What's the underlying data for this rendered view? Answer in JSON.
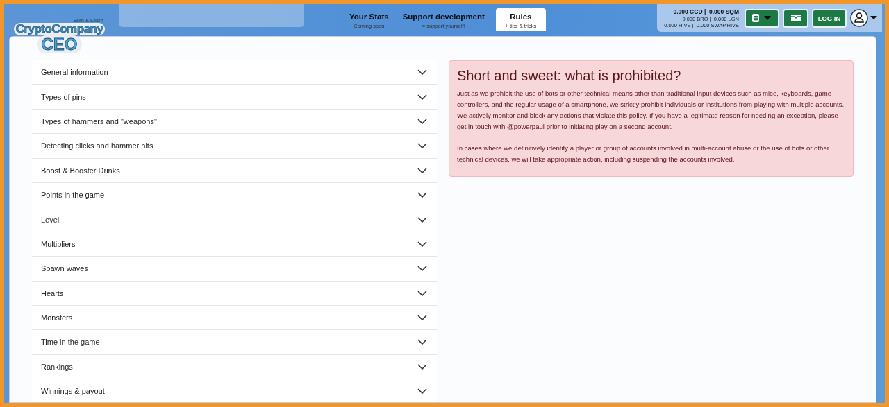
{
  "logo": {
    "top": "CryptoCompany",
    "main": "CEO",
    "tagline": "Earn & Learn"
  },
  "tabs": [
    {
      "label": "Your Stats",
      "sub": "Coming soon",
      "selected": false
    },
    {
      "label": "Support development",
      "sub": "= support yourself!",
      "selected": false
    },
    {
      "label": "Rules",
      "sub": "+ tips & tricks",
      "selected": true
    }
  ],
  "balances": {
    "main": "0.000 CCD |  0.000 SQM",
    "line_2": "0.000 BRO |  0.000 LGN",
    "line_3": "0.000 HIVE |  0.000 SWAP.HIVE"
  },
  "login_button": "LOG IN",
  "sections": [
    {
      "title": "General information",
      "expanded": false
    },
    {
      "title": "Types of pins",
      "expanded": false
    },
    {
      "title": "Types of hammers and \"weapons\"",
      "expanded": false
    },
    {
      "title": "Detecting clicks and hammer hits",
      "expanded": false
    },
    {
      "title": "Boost & Booster Drinks",
      "expanded": false
    },
    {
      "title": "Points in the game",
      "expanded": false
    },
    {
      "title": "Level",
      "expanded": false
    },
    {
      "title": "Multipliers",
      "expanded": false
    },
    {
      "title": "Spawn waves",
      "expanded": false
    },
    {
      "title": "Hearts",
      "expanded": false
    },
    {
      "title": "Monsters",
      "expanded": false
    },
    {
      "title": "Time in the game",
      "expanded": false
    },
    {
      "title": "Rankings",
      "expanded": false
    },
    {
      "title": "Winnings & payout",
      "expanded": false
    }
  ],
  "alert": {
    "title": "Short and sweet: what is prohibited?",
    "paragraphs": [
      "Just as we prohibit the use of bots or other technical means other than traditional input devices such as mice, keyboards, game controllers, and the regular usage of a smartphone, we strictly prohibit individuals or institutions from playing with multiple accounts. We actively monitor and block any actions that violate this policy. If you have a legitimate reason for needing an exception, please get in touch with @powerpaul prior to initiating play on a second account.",
      "In cases where we definitively identify a player or group of accounts involved in multi-account abuse or the use of bots or other technical devices, we will take appropriate action, including suspending the accounts involved."
    ]
  }
}
